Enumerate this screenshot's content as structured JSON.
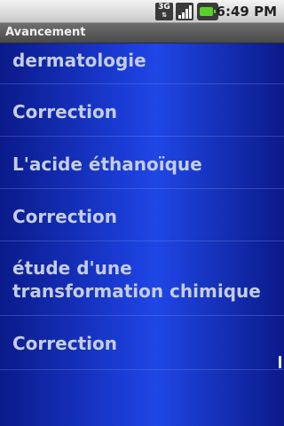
{
  "status_bar": {
    "network_label": "3G",
    "network_icon": "3g-data-icon",
    "signal_icon": "signal-strength-icon",
    "battery_icon": "battery-icon",
    "time": "6:49 PM"
  },
  "app": {
    "title": "Avancement"
  },
  "list": {
    "items": [
      {
        "label": "dermatologie"
      },
      {
        "label": "Correction"
      },
      {
        "label": "L'acide éthanoïque"
      },
      {
        "label": "Correction"
      },
      {
        "label_line1": "étude d'une",
        "label_line2": "transformation chimique"
      },
      {
        "label": "Correction"
      }
    ]
  },
  "colors": {
    "list_background": "#1f46e6",
    "item_text": "#c4cce2",
    "title_bar": "#5a5a5a"
  }
}
